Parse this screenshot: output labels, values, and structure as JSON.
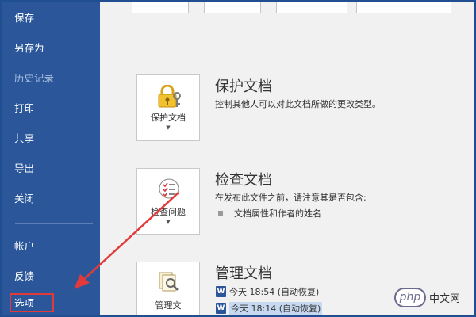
{
  "sidebar": {
    "items": [
      {
        "label": "保存"
      },
      {
        "label": "另存为"
      },
      {
        "label": "历史记录"
      },
      {
        "label": "打印"
      },
      {
        "label": "共享"
      },
      {
        "label": "导出"
      },
      {
        "label": "关闭"
      },
      {
        "label": "帐户"
      },
      {
        "label": "反馈"
      },
      {
        "label": "选项"
      }
    ]
  },
  "sections": {
    "protect": {
      "button_label": "保护文档",
      "title": "保护文档",
      "description": "控制其他人可以对此文档所做的更改类型。"
    },
    "inspect": {
      "button_label": "检查问题",
      "title": "检查文档",
      "description": "在发布此文件之前，请注意其是否包含:",
      "bullet": "文档属性和作者的姓名"
    },
    "manage": {
      "button_label": "管理文",
      "title": "管理文档",
      "versions": [
        {
          "text": "今天 18:54 (自动恢复)"
        },
        {
          "text": "今天 18:14 (自动恢复)"
        }
      ]
    }
  },
  "watermark": {
    "logo": "php",
    "text": "中文网"
  },
  "colors": {
    "sidebar_bg": "#2b579a",
    "content_bg": "#f1f1f1",
    "annotation_red": "#e23a3a"
  },
  "icons": [
    "lock-key-icon",
    "checklist-icon",
    "document-magnifier-icon",
    "word-file-icon",
    "caret-down-icon"
  ]
}
